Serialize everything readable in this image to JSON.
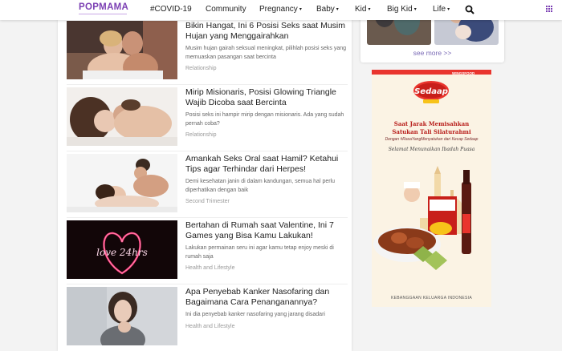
{
  "header": {
    "logo": "POPMAMA",
    "nav": [
      {
        "label": "#COVID-19",
        "has_dropdown": false
      },
      {
        "label": "Community",
        "has_dropdown": false
      },
      {
        "label": "Pregnancy",
        "has_dropdown": true
      },
      {
        "label": "Baby",
        "has_dropdown": true
      },
      {
        "label": "Kid",
        "has_dropdown": true
      },
      {
        "label": "Big Kid",
        "has_dropdown": true
      },
      {
        "label": "Life",
        "has_dropdown": true
      }
    ],
    "caret": "▾"
  },
  "articles": [
    {
      "title": "Bikin Hangat, Ini 6 Posisi Seks saat Musim Hujan yang Menggairahkan",
      "excerpt": "Musim hujan gairah seksual meningkat, pilihlah posisi seks yang memuaskan pasangan saat bercinta",
      "category": "Relationship"
    },
    {
      "title": "Mirip Misionaris, Posisi Glowing Triangle Wajib Dicoba saat Bercinta",
      "excerpt": "Posisi seks ini hampir mirip dengan misionaris. Ada yang sudah pernah coba?",
      "category": "Relationship"
    },
    {
      "title": "Amankah Seks Oral saat Hamil? Ketahui Tips agar Terhindar dari Herpes!",
      "excerpt": "Demi kesehatan janin di dalam kandungan, semua hal perlu diperhatikan dengan baik",
      "category": "Second Trimester"
    },
    {
      "title": "Bertahan di Rumah saat Valentine, Ini 7 Games yang Bisa Kamu Lakukan!",
      "excerpt": "Lakukan permainan seru ini agar kamu tetap enjoy meski di rumah saja",
      "category": "Health and Lifestyle",
      "image_text": "love 24hrs"
    },
    {
      "title": "Apa Penyebab Kanker Nasofaring dan Bagaimana Cara Penanganannya?",
      "excerpt": "Ini dia penyebab kanker nasofaring yang jarang disadari",
      "category": "Health and Lifestyle"
    }
  ],
  "sidebar": {
    "see_more": "see more >>"
  },
  "ad": {
    "brand_tag": "WINGSFOOD",
    "logo_text": "Sedaap",
    "headline_1": "Saat Jarak Memisahkan",
    "headline_2": "Satukan Tali Silaturahmi",
    "hashtag": "Dengan #RasaYangMenyatukan dari Kecap Sedaap",
    "greeting": "Selamat Menunaikan Ibadah Puasa",
    "footer": "KEBANGGAAN KELUARGA INDONESIA"
  },
  "colors": {
    "brand": "#7b3fb3",
    "see_more": "#7b6bb6",
    "ad_red": "#e9342d"
  }
}
